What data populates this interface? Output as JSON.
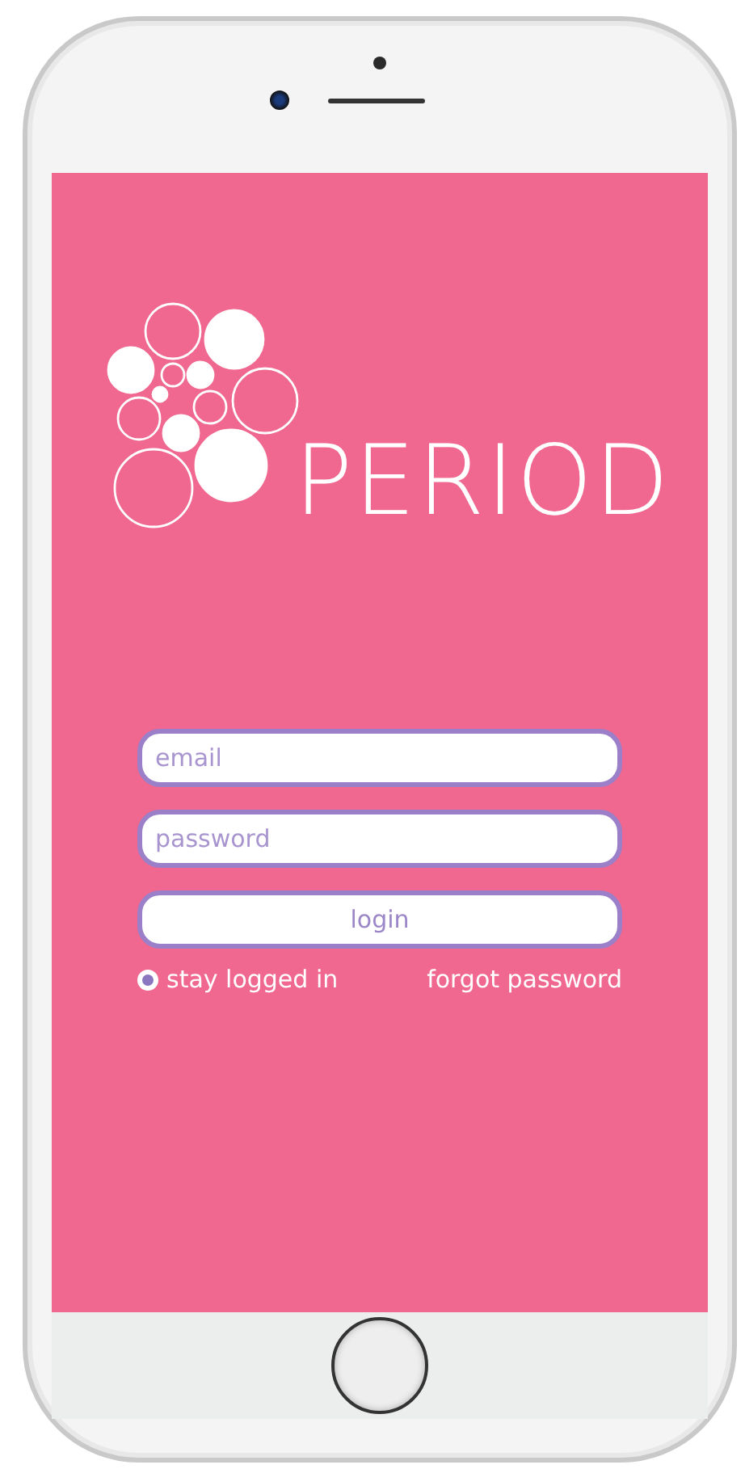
{
  "logo": {
    "wordmark": "PERIOD"
  },
  "login_form": {
    "email": {
      "placeholder": "email"
    },
    "password": {
      "placeholder": "password"
    },
    "login_button": "login"
  },
  "stay_logged_in": {
    "label": "stay logged in",
    "checked": true
  },
  "forgot_password": "forgot password"
}
